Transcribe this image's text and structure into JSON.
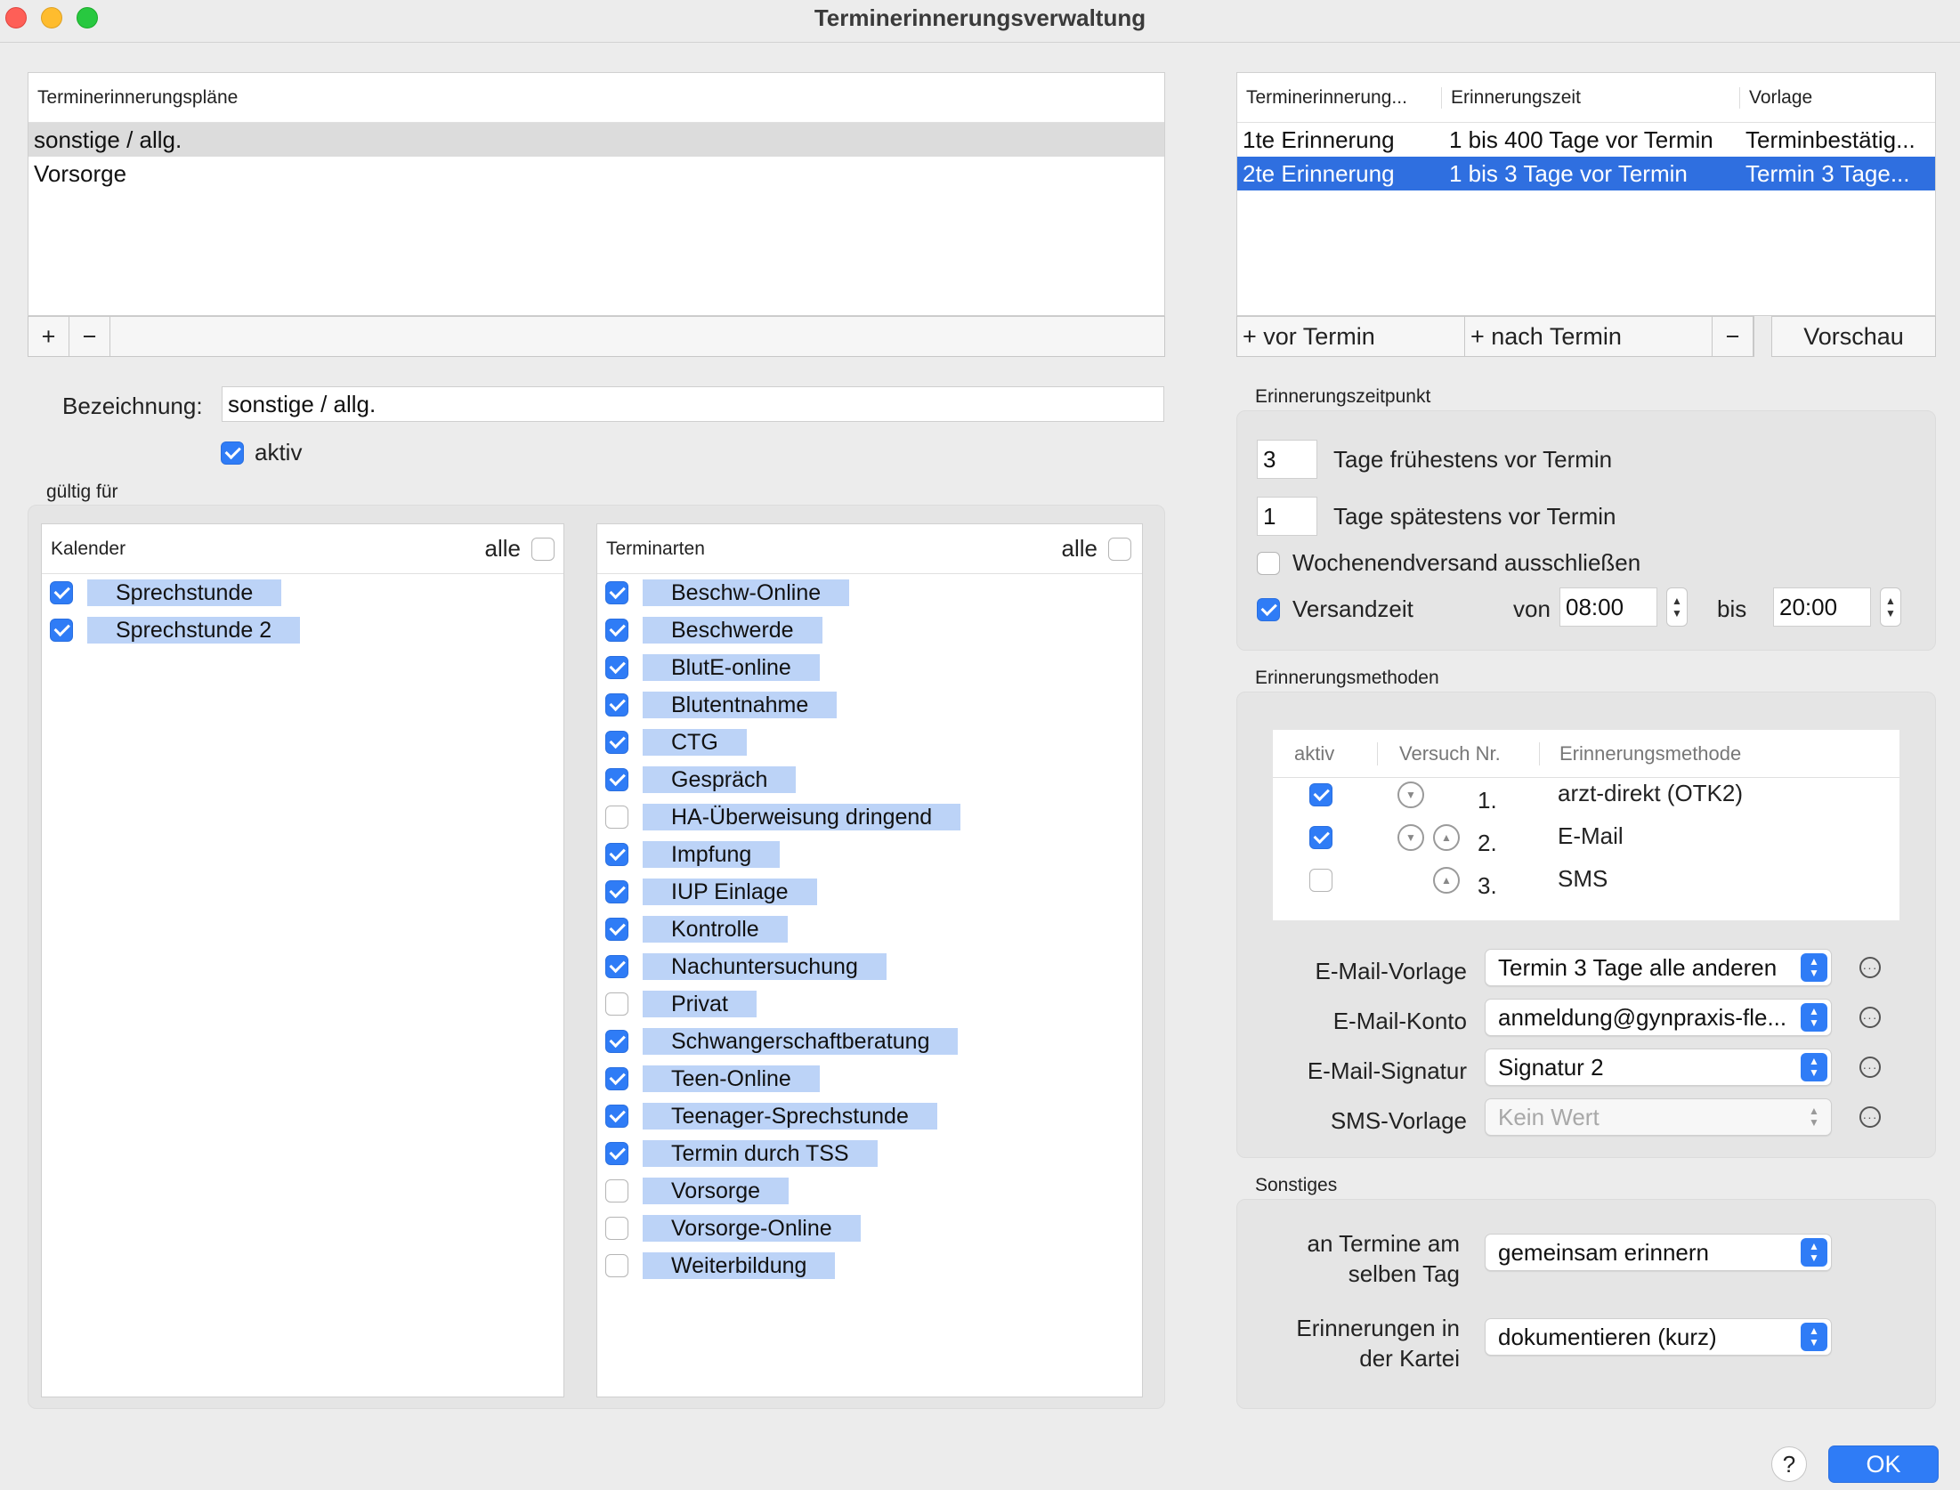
{
  "window": {
    "title": "Terminerinnerungsverwaltung"
  },
  "plans": {
    "header": "Terminerinnerungspläne",
    "rows": [
      "sonstige / allg.",
      "Vorsorge"
    ],
    "add": "+",
    "remove": "−"
  },
  "reminders": {
    "headers": [
      "Terminerinnerung...",
      "Erinnerungszeit",
      "Vorlage"
    ],
    "rows": [
      [
        "1te Erinnerung",
        "1 bis 400 Tage vor Termin",
        "Terminbestätig..."
      ],
      [
        "2te Erinnerung",
        "1 bis 3 Tage vor Termin",
        "Termin 3 Tage..."
      ]
    ],
    "btn_before": "+ vor Termin",
    "btn_after": "+ nach Termin",
    "btn_remove": "−",
    "btn_preview": "Vorschau"
  },
  "form": {
    "name_label": "Bezeichnung:",
    "name_value": "sonstige / allg.",
    "active_label": "aktiv",
    "valid_for": "gültig für"
  },
  "calendars": {
    "header": "Kalender",
    "all": "alle",
    "items": [
      {
        "label": "Sprechstunde",
        "checked": true
      },
      {
        "label": "Sprechstunde 2",
        "checked": true
      }
    ]
  },
  "types": {
    "header": "Terminarten",
    "all": "alle",
    "items": [
      {
        "label": "Beschw-Online",
        "checked": true
      },
      {
        "label": "Beschwerde",
        "checked": true
      },
      {
        "label": "BlutE-online",
        "checked": true
      },
      {
        "label": "Blutentnahme",
        "checked": true
      },
      {
        "label": "CTG",
        "checked": true
      },
      {
        "label": "Gespräch",
        "checked": true
      },
      {
        "label": "HA-Überweisung dringend",
        "checked": false
      },
      {
        "label": "Impfung",
        "checked": true
      },
      {
        "label": "IUP Einlage",
        "checked": true
      },
      {
        "label": "Kontrolle",
        "checked": true
      },
      {
        "label": "Nachuntersuchung",
        "checked": true
      },
      {
        "label": "Privat",
        "checked": false
      },
      {
        "label": "Schwangerschaftberatung",
        "checked": true
      },
      {
        "label": "Teen-Online",
        "checked": true
      },
      {
        "label": "Teenager-Sprechstunde",
        "checked": true
      },
      {
        "label": "Termin durch TSS",
        "checked": true
      },
      {
        "label": "Vorsorge",
        "checked": false
      },
      {
        "label": "Vorsorge-Online",
        "checked": false
      },
      {
        "label": "Weiterbildung",
        "checked": false
      }
    ]
  },
  "timing": {
    "section": "Erinnerungszeitpunkt",
    "earliest_value": "3",
    "earliest_label": "Tage frühestens vor Termin",
    "latest_value": "1",
    "latest_label": "Tage spätestens vor Termin",
    "weekend_label": "Wochenendversand ausschließen",
    "sendtime_label": "Versandzeit",
    "from_label": "von",
    "from_value": "08:00",
    "to_label": "bis",
    "to_value": "20:00"
  },
  "methods": {
    "section": "Erinnerungsmethoden",
    "headers": [
      "aktiv",
      "Versuch Nr.",
      "Erinnerungsmethode"
    ],
    "rows": [
      {
        "active": true,
        "nr": "1.",
        "method": "arzt-direkt (OTK2)"
      },
      {
        "active": true,
        "nr": "2.",
        "method": "E-Mail"
      },
      {
        "active": false,
        "nr": "3.",
        "method": "SMS"
      }
    ],
    "email_template_label": "E-Mail-Vorlage",
    "email_template_value": "Termin 3 Tage alle anderen",
    "email_account_label": "E-Mail-Konto",
    "email_account_value": "anmeldung@gynpraxis-fle...",
    "email_signature_label": "E-Mail-Signatur",
    "email_signature_value": "Signatur 2",
    "sms_template_label": "SMS-Vorlage",
    "sms_template_value": "Kein Wert"
  },
  "misc": {
    "section": "Sonstiges",
    "same_day_label_1": "an Termine am",
    "same_day_label_2": "selben Tag",
    "same_day_value": "gemeinsam erinnern",
    "file_label_1": "Erinnerungen in",
    "file_label_2": "der Kartei",
    "file_value": "dokumentieren (kurz)"
  },
  "footer": {
    "help": "?",
    "ok": "OK"
  },
  "colors": {
    "accent": "#2f7cf6",
    "selection": "#2f6fe0",
    "tag": "#bcd3f7"
  }
}
